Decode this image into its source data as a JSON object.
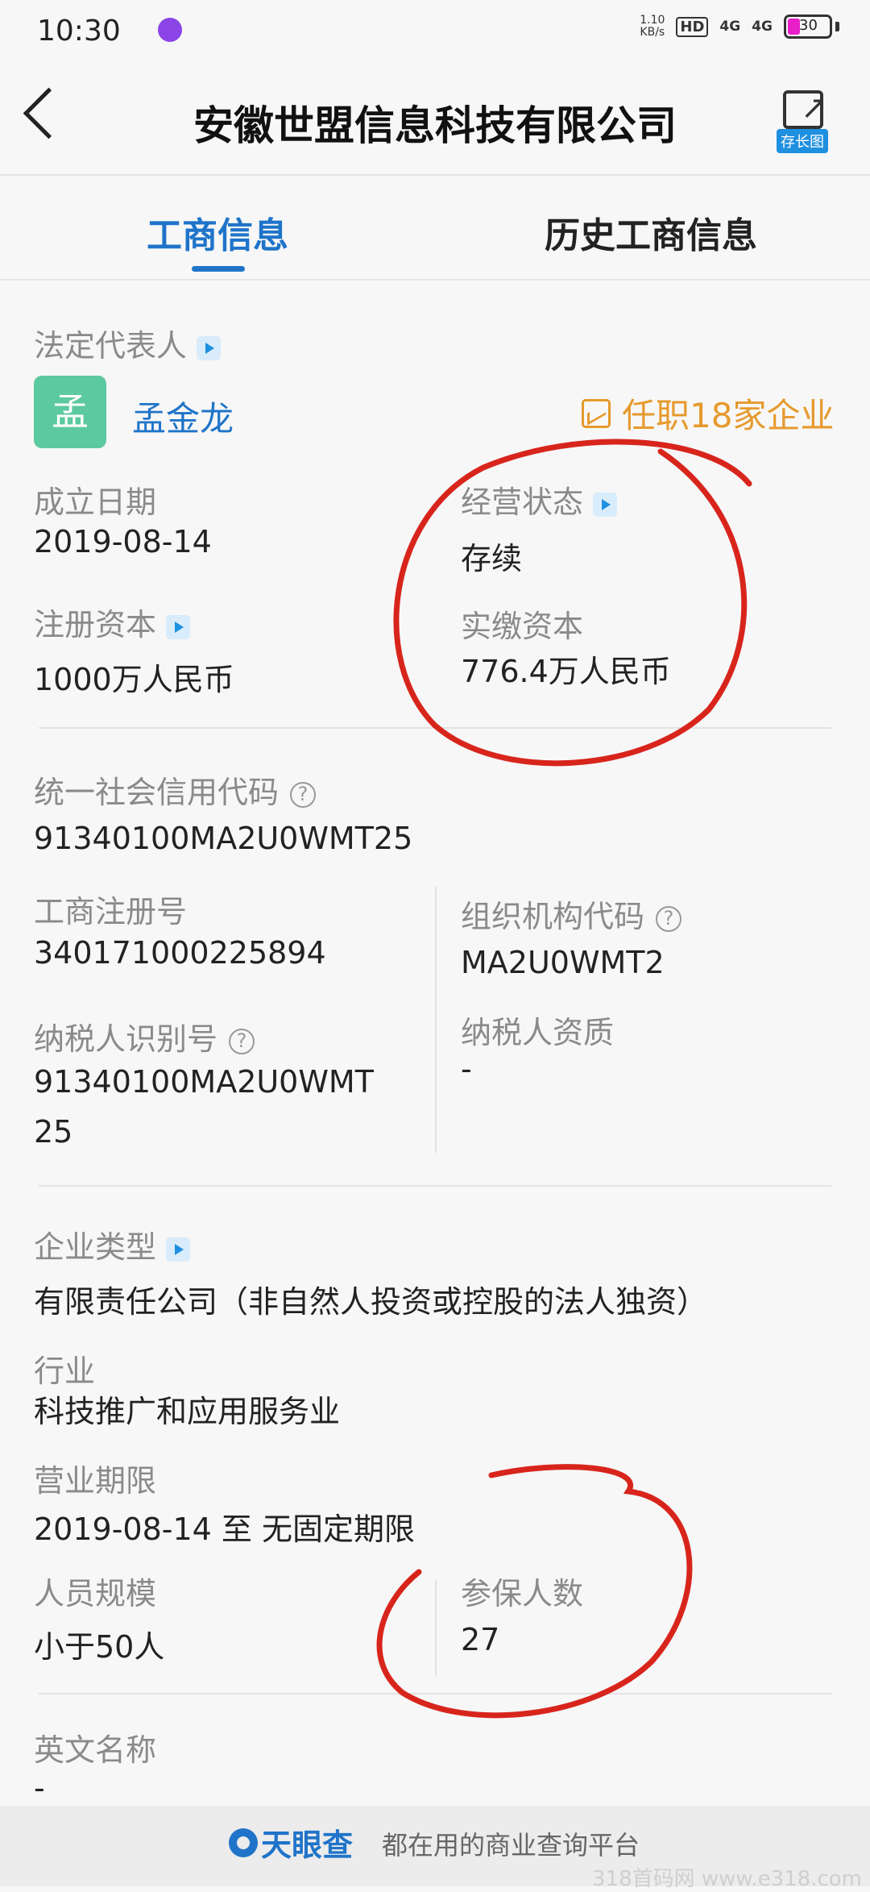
{
  "status_bar": {
    "time": "10:30",
    "net_speed": "1.10",
    "net_unit": "KB/s",
    "hd_label": "HD",
    "signal_1": "4G",
    "signal_2": "4G",
    "battery": "30",
    "battery_level": 0.3
  },
  "header": {
    "title": "安徽世盟信息科技有限公司",
    "save_image_label": "存长图"
  },
  "tabs": [
    {
      "label": "工商信息",
      "active": true
    },
    {
      "label": "历史工商信息",
      "active": false
    }
  ],
  "legal_rep": {
    "label": "法定代表人",
    "avatar_char": "孟",
    "name": "孟金龙",
    "positions": "任职18家企业"
  },
  "fields": {
    "founded": {
      "label": "成立日期",
      "value": "2019-08-14"
    },
    "status": {
      "label": "经营状态",
      "value": "存续"
    },
    "reg_capital": {
      "label": "注册资本",
      "value": "1000万人民币"
    },
    "paid_capital": {
      "label": "实缴资本",
      "value": "776.4万人民币"
    },
    "credit_code": {
      "label": "统一社会信用代码",
      "value": "91340100MA2U0WMT25"
    },
    "reg_number": {
      "label": "工商注册号",
      "value": "340171000225894"
    },
    "org_code": {
      "label": "组织机构代码",
      "value": "MA2U0WMT2"
    },
    "taxpayer_id": {
      "label": "纳税人识别号",
      "value_line1": "91340100MA2U0WMT",
      "value_line2": "25"
    },
    "taxpayer_qual": {
      "label": "纳税人资质",
      "value": "-"
    },
    "company_type": {
      "label": "企业类型",
      "value": "有限责任公司（非自然人投资或控股的法人独资）"
    },
    "industry": {
      "label": "行业",
      "value": "科技推广和应用服务业"
    },
    "term": {
      "label": "营业期限",
      "value": "2019-08-14 至 无固定期限"
    },
    "staff_size": {
      "label": "人员规模",
      "value": "小于50人"
    },
    "insured": {
      "label": "参保人数",
      "value": "27"
    },
    "english_name": {
      "label": "英文名称",
      "value": "-"
    }
  },
  "footer": {
    "brand": "天眼查",
    "slogan": "都在用的商业查询平台",
    "watermark": "318首码网 www.e318.com"
  },
  "colors": {
    "accent": "#1f74c9",
    "warning": "#e69a2e",
    "annotation": "#d8251c"
  }
}
